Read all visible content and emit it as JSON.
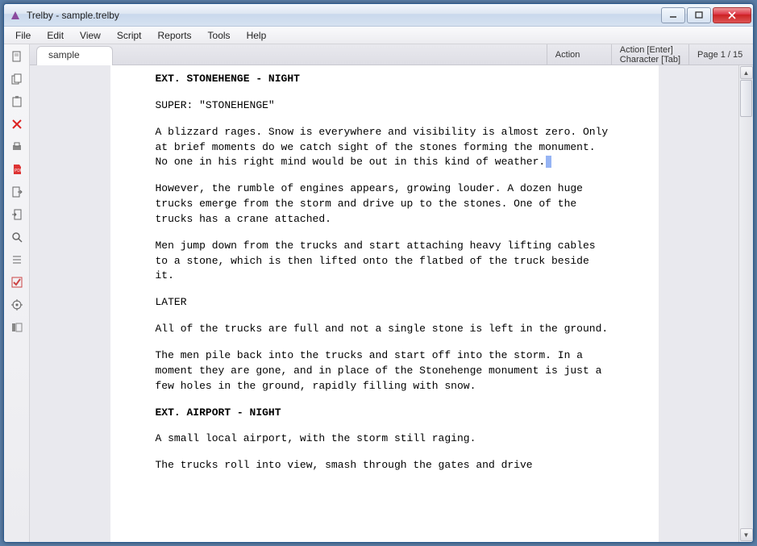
{
  "window": {
    "title": "Trelby - sample.trelby"
  },
  "menu": {
    "items": [
      "File",
      "Edit",
      "View",
      "Script",
      "Reports",
      "Tools",
      "Help"
    ]
  },
  "sidebar": {
    "tools": [
      {
        "name": "new-doc-icon"
      },
      {
        "name": "copy-icon"
      },
      {
        "name": "paste-icon"
      },
      {
        "name": "delete-icon"
      },
      {
        "name": "print-icon"
      },
      {
        "name": "pdf-icon"
      },
      {
        "name": "export-icon"
      },
      {
        "name": "import-icon"
      },
      {
        "name": "search-icon"
      },
      {
        "name": "list-icon"
      },
      {
        "name": "check-icon"
      },
      {
        "name": "settings-icon"
      },
      {
        "name": "sidebar-icon"
      }
    ]
  },
  "tabs": [
    {
      "label": "sample"
    }
  ],
  "statusbar": {
    "element": "Action",
    "next_enter": "Action [Enter]",
    "next_tab": "Character [Tab]",
    "page": "Page 1 / 15"
  },
  "script": {
    "blocks": [
      {
        "type": "scene",
        "text": "EXT. STONEHENGE - NIGHT"
      },
      {
        "type": "action",
        "text": "SUPER: \"STONEHENGE\""
      },
      {
        "type": "action",
        "text": "A blizzard rages. Snow is everywhere and visibility is almost zero. Only at brief moments do we catch sight of the stones forming the monument. No one in his right mind would be out in this kind of weather.",
        "cursor": true
      },
      {
        "type": "action",
        "text": "However, the rumble of engines appears, growing louder. A dozen huge trucks emerge from the storm and drive up to the stones. One of the trucks has a crane attached."
      },
      {
        "type": "action",
        "text": "Men jump down from the trucks and start attaching heavy lifting cables to a stone, which is then lifted onto the flatbed of the truck beside it."
      },
      {
        "type": "action",
        "text": "LATER"
      },
      {
        "type": "action",
        "text": "All of the trucks are full and not a single stone is left in the ground."
      },
      {
        "type": "action",
        "text": "The men pile back into the trucks and start off into the storm. In a moment they are gone, and in place of the Stonehenge monument is just a few holes in the ground, rapidly filling with snow."
      },
      {
        "type": "scene",
        "text": "EXT. AIRPORT - NIGHT"
      },
      {
        "type": "action",
        "text": "A small local airport, with the storm still raging."
      },
      {
        "type": "action",
        "text": "The trucks roll into view, smash through the gates and drive"
      }
    ]
  }
}
